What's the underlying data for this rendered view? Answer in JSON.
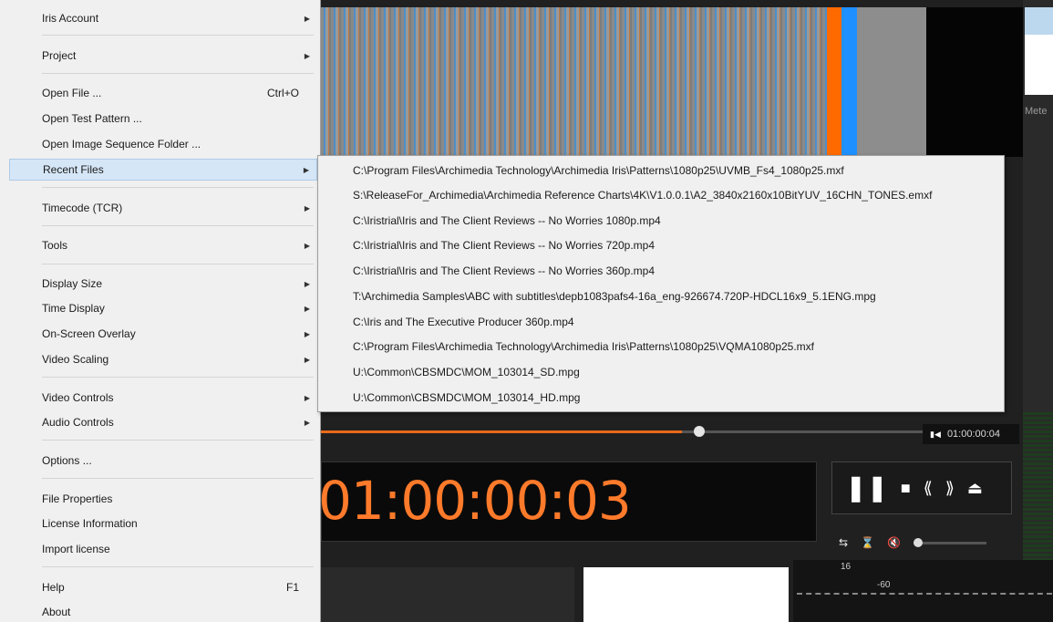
{
  "menu": {
    "items": [
      {
        "label": "Iris Account",
        "shortcut": "",
        "submenu": true
      },
      {
        "label": "Project",
        "shortcut": "",
        "submenu": true
      },
      {
        "label": "Open File ...",
        "shortcut": "Ctrl+O",
        "submenu": false
      },
      {
        "label": "Open Test Pattern ...",
        "shortcut": "",
        "submenu": false
      },
      {
        "label": "Open Image Sequence Folder ...",
        "shortcut": "",
        "submenu": false
      },
      {
        "label": "Recent Files",
        "shortcut": "",
        "submenu": true,
        "highlighted": true
      },
      {
        "label": "Timecode (TCR)",
        "shortcut": "",
        "submenu": true
      },
      {
        "label": "Tools",
        "shortcut": "",
        "submenu": true
      },
      {
        "label": "Display Size",
        "shortcut": "",
        "submenu": true
      },
      {
        "label": "Time Display",
        "shortcut": "",
        "submenu": true
      },
      {
        "label": "On-Screen Overlay",
        "shortcut": "",
        "submenu": true
      },
      {
        "label": "Video Scaling",
        "shortcut": "",
        "submenu": true
      },
      {
        "label": "Video Controls",
        "shortcut": "",
        "submenu": true
      },
      {
        "label": "Audio Controls",
        "shortcut": "",
        "submenu": true
      },
      {
        "label": "Options ...",
        "shortcut": "",
        "submenu": false
      },
      {
        "label": "File Properties",
        "shortcut": "",
        "submenu": false
      },
      {
        "label": "License Information",
        "shortcut": "",
        "submenu": false
      },
      {
        "label": "Import license",
        "shortcut": "",
        "submenu": false
      },
      {
        "label": "Help",
        "shortcut": "F1",
        "submenu": false
      },
      {
        "label": "About",
        "shortcut": "",
        "submenu": false
      }
    ]
  },
  "recent_files": [
    "C:\\Program Files\\Archimedia Technology\\Archimedia Iris\\Patterns\\1080p25\\UVMB_Fs4_1080p25.mxf",
    "S:\\ReleaseFor_Archimedia\\Archimedia Reference Charts\\4K\\V1.0.0.1\\A2_3840x2160x10BitYUV_16CHN_TONES.emxf",
    "C:\\Iristrial\\Iris and The Client Reviews -- No Worries 1080p.mp4",
    "C:\\Iristrial\\Iris and The Client Reviews -- No Worries 720p.mp4",
    "C:\\Iristrial\\Iris and The Client Reviews -- No Worries 360p.mp4",
    "T:\\Archimedia Samples\\ABC with subtitles\\depb1083pafs4-16a_eng-926674.720P-HDCL16x9_5.1ENG.mpg",
    "C:\\Iris and The Executive Producer 360p.mp4",
    "C:\\Program Files\\Archimedia Technology\\Archimedia Iris\\Patterns\\1080p25\\VQMA1080p25.mxf",
    "U:\\Common\\CBSMDC\\MOM_103014_SD.mpg",
    "U:\\Common\\CBSMDC\\MOM_103014_HD.mpg"
  ],
  "player": {
    "timecode_main": "01:00:00:03",
    "timecode_small": "01:00:00:04",
    "seek_progress": 0.6,
    "meters_label": "Mete",
    "scope_label": "16",
    "scope_tick": "-60"
  },
  "icons": {
    "pause": "pause-icon",
    "stop": "stop-icon",
    "rewind": "rewind-icon",
    "fast_forward": "fast-forward-icon",
    "eject": "eject-icon",
    "loop": "loop-icon",
    "hourglass": "hourglass-icon",
    "mute": "mute-icon",
    "submenu_arrow": "chevron-right-icon"
  },
  "colors": {
    "timecode": "#ff7a2a",
    "menu_highlight": "#d5e6f7",
    "menu_bg": "#f0f0f0"
  }
}
